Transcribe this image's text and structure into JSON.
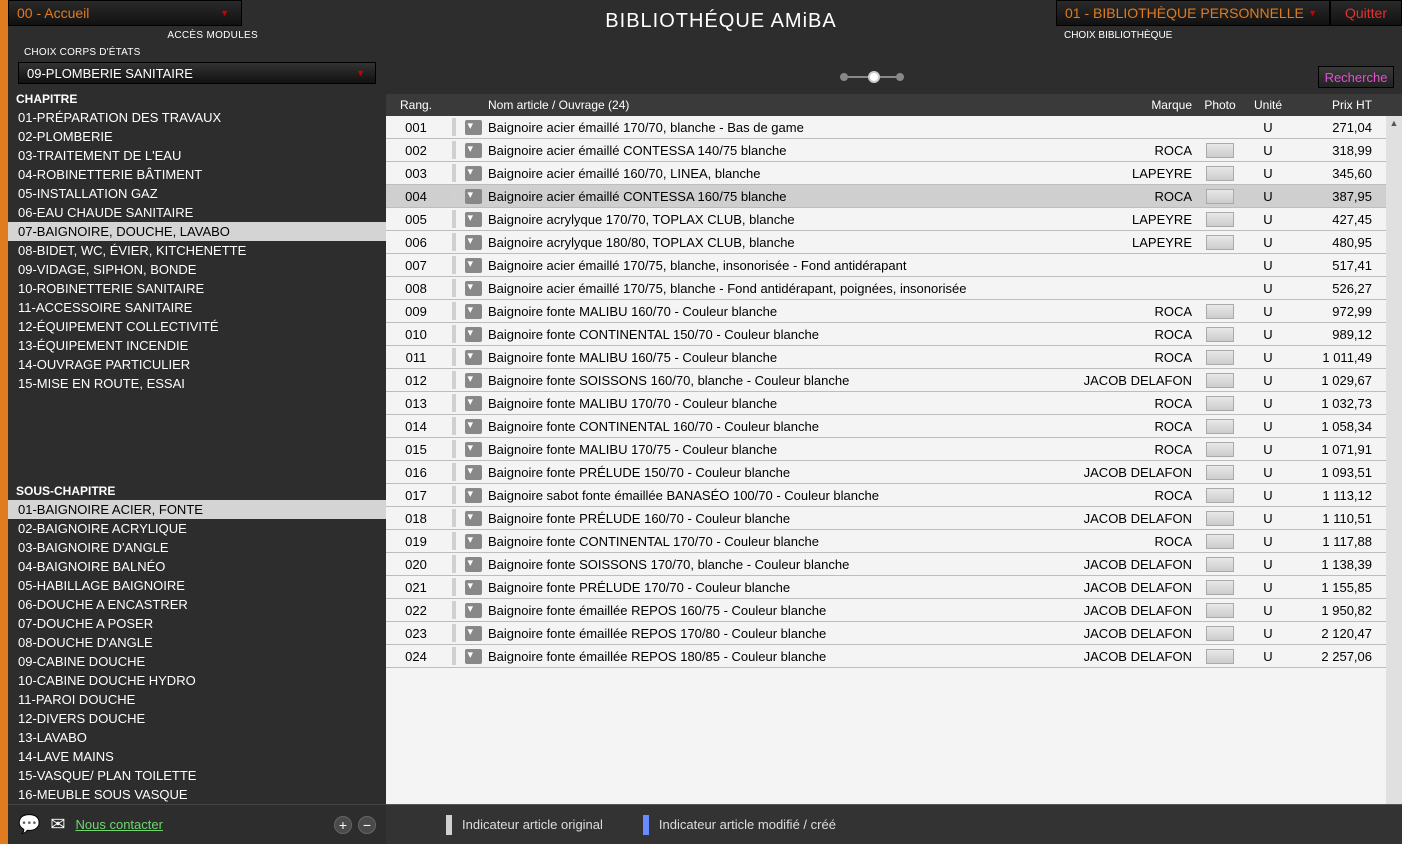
{
  "topLeft": {
    "accueil": "00 - Accueil",
    "accesModules": "ACCÈS MODULES"
  },
  "sidebar": {
    "choixCorps": "CHOIX CORPS D'ÉTATS",
    "corpsSelected": "09-PLOMBERIE SANITAIRE",
    "chapitreTitle": "CHAPITRE",
    "chapitres": [
      "01-PRÉPARATION DES TRAVAUX",
      "02-PLOMBERIE",
      "03-TRAITEMENT DE L'EAU",
      "04-ROBINETTERIE BÂTIMENT",
      "05-INSTALLATION GAZ",
      "06-EAU CHAUDE SANITAIRE",
      "07-BAIGNOIRE, DOUCHE, LAVABO",
      "08-BIDET, WC, ÉVIER, KITCHENETTE",
      "09-VIDAGE, SIPHON, BONDE",
      "10-ROBINETTERIE SANITAIRE",
      "11-ACCESSOIRE SANITAIRE",
      "12-ÉQUIPEMENT COLLECTIVITÉ",
      "13-ÉQUIPEMENT INCENDIE",
      "14-OUVRAGE PARTICULIER",
      "15-MISE EN ROUTE, ESSAI"
    ],
    "chapitreSelected": 6,
    "sousTitle": "SOUS-CHAPITRE",
    "sousChapitres": [
      "01-BAIGNOIRE ACIER, FONTE",
      "02-BAIGNOIRE ACRYLIQUE",
      "03-BAIGNOIRE D'ANGLE",
      "04-BAIGNOIRE BALNÉO",
      "05-HABILLAGE BAIGNOIRE",
      "06-DOUCHE A ENCASTRER",
      "07-DOUCHE A POSER",
      "08-DOUCHE D'ANGLE",
      "09-CABINE DOUCHE",
      "10-CABINE DOUCHE HYDRO",
      "11-PAROI DOUCHE",
      "12-DIVERS DOUCHE",
      "13-LAVABO",
      "14-LAVE MAINS",
      "15-VASQUE/ PLAN TOILETTE",
      "16-MEUBLE SOUS VASQUE"
    ],
    "sousSelected": 0,
    "contact": "Nous contacter"
  },
  "header": {
    "title": "BIBLIOTHÉQUE AMiBA",
    "bibSelect": "01 - BIBLIOTHÈQUE PERSONNELLE",
    "quitter": "Quitter",
    "choixBib": "CHOIX BIBLIOTHÈQUE",
    "recherche": "Recherche"
  },
  "table": {
    "headers": {
      "rang": "Rang.",
      "name": "Nom article / Ouvrage (24)",
      "marque": "Marque",
      "photo": "Photo",
      "unite": "Unité",
      "prix": "Prix HT"
    },
    "selected": 3,
    "rows": [
      {
        "rang": "001",
        "name": "Baignoire acier émaillé 170/70, blanche - Bas de game",
        "marque": "",
        "photo": false,
        "unite": "U",
        "prix": "271,04"
      },
      {
        "rang": "002",
        "name": "Baignoire acier émaillé CONTESSA 140/75 blanche",
        "marque": "ROCA",
        "photo": true,
        "unite": "U",
        "prix": "318,99"
      },
      {
        "rang": "003",
        "name": "Baignoire acier émaillé 160/70, LINEA, blanche",
        "marque": "LAPEYRE",
        "photo": true,
        "unite": "U",
        "prix": "345,60"
      },
      {
        "rang": "004",
        "name": "Baignoire acier émaillé CONTESSA 160/75 blanche",
        "marque": "ROCA",
        "photo": true,
        "unite": "U",
        "prix": "387,95"
      },
      {
        "rang": "005",
        "name": "Baignoire acrylyque 170/70, TOPLAX CLUB, blanche",
        "marque": "LAPEYRE",
        "photo": true,
        "unite": "U",
        "prix": "427,45"
      },
      {
        "rang": "006",
        "name": "Baignoire acrylyque 180/80, TOPLAX CLUB, blanche",
        "marque": "LAPEYRE",
        "photo": true,
        "unite": "U",
        "prix": "480,95"
      },
      {
        "rang": "007",
        "name": "Baignoire acier émaillé 170/75, blanche, insonorisée - Fond antidérapant",
        "marque": "",
        "photo": false,
        "unite": "U",
        "prix": "517,41"
      },
      {
        "rang": "008",
        "name": "Baignoire acier émaillé 170/75, blanche - Fond antidérapant, poignées, insonorisée",
        "marque": "",
        "photo": false,
        "unite": "U",
        "prix": "526,27"
      },
      {
        "rang": "009",
        "name": "Baignoire fonte MALIBU 160/70 - Couleur blanche",
        "marque": "ROCA",
        "photo": true,
        "unite": "U",
        "prix": "972,99"
      },
      {
        "rang": "010",
        "name": "Baignoire fonte CONTINENTAL 150/70 - Couleur blanche",
        "marque": "ROCA",
        "photo": true,
        "unite": "U",
        "prix": "989,12"
      },
      {
        "rang": "011",
        "name": "Baignoire fonte MALIBU 160/75 - Couleur blanche",
        "marque": "ROCA",
        "photo": true,
        "unite": "U",
        "prix": "1 011,49"
      },
      {
        "rang": "012",
        "name": "Baignoire fonte SOISSONS 160/70, blanche - Couleur blanche",
        "marque": "JACOB DELAFON",
        "photo": true,
        "unite": "U",
        "prix": "1 029,67"
      },
      {
        "rang": "013",
        "name": "Baignoire fonte MALIBU 170/70 - Couleur blanche",
        "marque": "ROCA",
        "photo": true,
        "unite": "U",
        "prix": "1 032,73"
      },
      {
        "rang": "014",
        "name": "Baignoire fonte CONTINENTAL 160/70 - Couleur blanche",
        "marque": "ROCA",
        "photo": true,
        "unite": "U",
        "prix": "1 058,34"
      },
      {
        "rang": "015",
        "name": "Baignoire fonte MALIBU 170/75 - Couleur blanche",
        "marque": "ROCA",
        "photo": true,
        "unite": "U",
        "prix": "1 071,91"
      },
      {
        "rang": "016",
        "name": "Baignoire fonte PRÉLUDE 150/70 - Couleur blanche",
        "marque": "JACOB DELAFON",
        "photo": true,
        "unite": "U",
        "prix": "1 093,51"
      },
      {
        "rang": "017",
        "name": "Baignoire sabot fonte émaillée BANASÉO 100/70 - Couleur blanche",
        "marque": "ROCA",
        "photo": true,
        "unite": "U",
        "prix": "1 113,12"
      },
      {
        "rang": "018",
        "name": "Baignoire fonte PRÉLUDE 160/70 - Couleur blanche",
        "marque": "JACOB DELAFON",
        "photo": true,
        "unite": "U",
        "prix": "1 110,51"
      },
      {
        "rang": "019",
        "name": "Baignoire fonte CONTINENTAL 170/70 - Couleur blanche",
        "marque": "ROCA",
        "photo": true,
        "unite": "U",
        "prix": "1 117,88"
      },
      {
        "rang": "020",
        "name": "Baignoire fonte SOISSONS 170/70, blanche - Couleur blanche",
        "marque": "JACOB DELAFON",
        "photo": true,
        "unite": "U",
        "prix": "1 138,39"
      },
      {
        "rang": "021",
        "name": "Baignoire fonte PRÉLUDE 170/70 - Couleur blanche",
        "marque": "JACOB DELAFON",
        "photo": true,
        "unite": "U",
        "prix": "1 155,85"
      },
      {
        "rang": "022",
        "name": "Baignoire fonte émaillée REPOS 160/75 - Couleur blanche",
        "marque": "JACOB DELAFON",
        "photo": true,
        "unite": "U",
        "prix": "1 950,82"
      },
      {
        "rang": "023",
        "name": "Baignoire fonte émaillée REPOS 170/80 - Couleur blanche",
        "marque": "JACOB DELAFON",
        "photo": true,
        "unite": "U",
        "prix": "2 120,47"
      },
      {
        "rang": "024",
        "name": "Baignoire fonte émaillée REPOS 180/85 - Couleur blanche",
        "marque": "JACOB DELAFON",
        "photo": true,
        "unite": "U",
        "prix": "2 257,06"
      }
    ]
  },
  "legend": {
    "original": "Indicateur article original",
    "modifie": "Indicateur article modifié / créé",
    "colorOriginal": "#d0d0d0",
    "colorModifie": "#6a8aff"
  }
}
